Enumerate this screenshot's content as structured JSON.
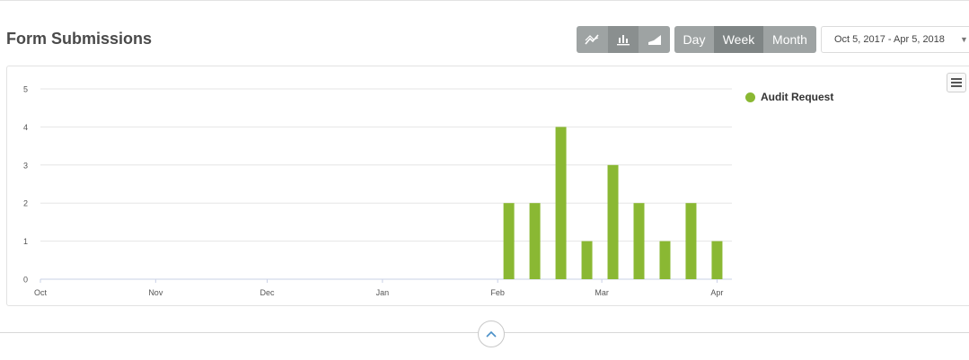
{
  "header": {
    "title": "Form Submissions",
    "period_options": [
      {
        "label": "Day",
        "active": false
      },
      {
        "label": "Week",
        "active": true
      },
      {
        "label": "Month",
        "active": false
      }
    ],
    "chart_type_icons": [
      "line-chart-icon",
      "bar-chart-icon",
      "area-chart-icon"
    ],
    "active_chart_type": "bar-chart-icon",
    "date_range": "Oct 5, 2017 - Apr 5, 2018"
  },
  "colors": {
    "bar": "#8ab833",
    "button": "#9ea3a3",
    "button_active": "#7f8585"
  },
  "chart_data": {
    "type": "bar",
    "series": [
      {
        "name": "Audit Request",
        "color": "#8ab833",
        "points": [
          {
            "x": "2018-02-04",
            "y": 2
          },
          {
            "x": "2018-02-11",
            "y": 2
          },
          {
            "x": "2018-02-18",
            "y": 4
          },
          {
            "x": "2018-02-25",
            "y": 1
          },
          {
            "x": "2018-03-04",
            "y": 3
          },
          {
            "x": "2018-03-11",
            "y": 2
          },
          {
            "x": "2018-03-18",
            "y": 1
          },
          {
            "x": "2018-03-25",
            "y": 2
          },
          {
            "x": "2018-04-01",
            "y": 1
          }
        ]
      }
    ],
    "x_ticks": [
      {
        "label": "Oct",
        "date": "2017-10-01"
      },
      {
        "label": "Nov",
        "date": "2017-11-01"
      },
      {
        "label": "Dec",
        "date": "2017-12-01"
      },
      {
        "label": "Jan",
        "date": "2018-01-01"
      },
      {
        "label": "Feb",
        "date": "2018-02-01"
      },
      {
        "label": "Mar",
        "date": "2018-03-01"
      },
      {
        "label": "Apr",
        "date": "2018-04-01"
      }
    ],
    "xlim": [
      "2017-10-01",
      "2018-04-05"
    ],
    "y_ticks": [
      0,
      1,
      2,
      3,
      4,
      5
    ],
    "ylim": [
      0,
      5
    ],
    "grid": true,
    "legend": "top-right"
  }
}
